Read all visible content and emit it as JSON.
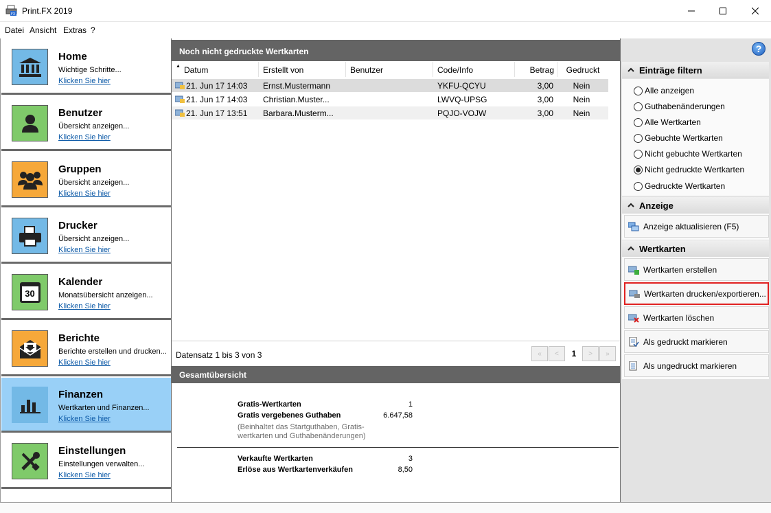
{
  "window": {
    "title": "Print.FX 2019"
  },
  "menu": [
    "Datei",
    "Ansicht",
    "Extras",
    "?"
  ],
  "nav": [
    {
      "title": "Home",
      "desc": "Wichtige Schritte...",
      "link": "Klicken Sie hier",
      "icon": "bank-icon"
    },
    {
      "title": "Benutzer",
      "desc": "Übersicht anzeigen...",
      "link": "Klicken Sie hier",
      "icon": "user-icon"
    },
    {
      "title": "Gruppen",
      "desc": "Übersicht anzeigen...",
      "link": "Klicken Sie hier",
      "icon": "group-icon"
    },
    {
      "title": "Drucker",
      "desc": "Übersicht anzeigen...",
      "link": "Klicken Sie hier",
      "icon": "printer-icon"
    },
    {
      "title": "Kalender",
      "desc": "Monatsübersicht anzeigen...",
      "link": "Klicken Sie hier",
      "icon": "calendar-icon",
      "icon_text": "30"
    },
    {
      "title": "Berichte",
      "desc": "Berichte erstellen und drucken...",
      "link": "Klicken Sie hier",
      "icon": "report-icon"
    },
    {
      "title": "Finanzen",
      "desc": "Wertkarten und Finanzen...",
      "link": "Klicken Sie hier",
      "icon": "bar-chart-icon"
    },
    {
      "title": "Einstellungen",
      "desc": "Einstellungen verwalten...",
      "link": "Klicken Sie hier",
      "icon": "tools-icon"
    }
  ],
  "list": {
    "title": "Noch nicht gedruckte Wertkarten",
    "columns": [
      "Datum",
      "Erstellt von",
      "Benutzer",
      "Code/Info",
      "Betrag",
      "Gedruckt"
    ],
    "rows": [
      {
        "datum": "21. Jun 17 14:03",
        "erstellt": "Ernst.Mustermann",
        "benutzer": "",
        "code": "YKFU-QCYU",
        "betrag": "3,00",
        "gedruckt": "Nein"
      },
      {
        "datum": "21. Jun 17 14:03",
        "erstellt": "Christian.Muster...",
        "benutzer": "",
        "code": "LWVQ-UPSG",
        "betrag": "3,00",
        "gedruckt": "Nein"
      },
      {
        "datum": "21. Jun 17 13:51",
        "erstellt": "Barbara.Musterm...",
        "benutzer": "",
        "code": "PQJO-VOJW",
        "betrag": "3,00",
        "gedruckt": "Nein"
      }
    ],
    "pager_text": "Datensatz 1 bis 3 von 3",
    "page": "1"
  },
  "summary": {
    "title": "Gesamtübersicht",
    "gratis_label": "Gratis-Wertkarten",
    "gratis_value": "1",
    "guthaben_label": "Gratis vergebenes Guthaben",
    "guthaben_value": "6.647,58",
    "note_line1": "(Beinhaltet das Startguthaben, Gratis-",
    "note_line2": "wertkarten und Guthabenänderungen)",
    "verkauft_label": "Verkaufte Wertkarten",
    "verkauft_value": "3",
    "erloese_label": "Erlöse aus Wertkartenverkäufen",
    "erloese_value": "8,50"
  },
  "filter": {
    "title": "Einträge filtern",
    "options": [
      "Alle anzeigen",
      "Guthabenänderungen",
      "Alle Wertkarten",
      "Gebuchte Wertkarten",
      "Nicht gebuchte Wertkarten",
      "Nicht gedruckte Wertkarten",
      "Gedruckte Wertkarten"
    ],
    "selected": "Nicht gedruckte Wertkarten"
  },
  "anzeige": {
    "title": "Anzeige",
    "refresh": "Anzeige aktualisieren (F5)"
  },
  "wertkarten": {
    "title": "Wertkarten",
    "actions": [
      "Wertkarten erstellen",
      "Wertkarten drucken/exportieren...",
      "Wertkarten löschen",
      "Als gedruckt markieren",
      "Als ungedruckt markieren"
    ]
  }
}
